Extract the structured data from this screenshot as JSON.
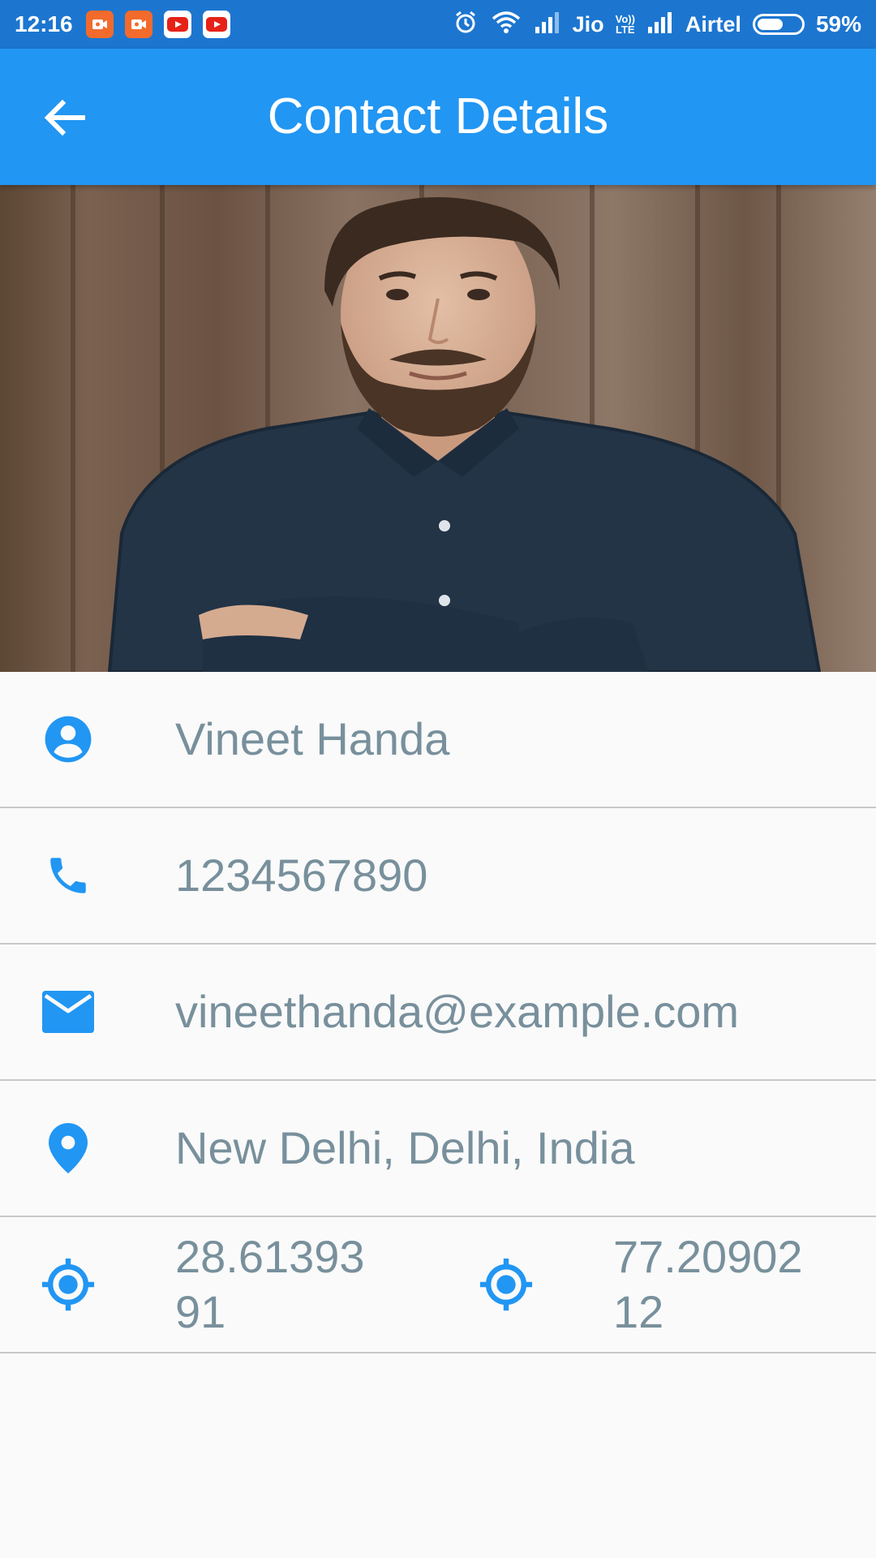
{
  "status_bar": {
    "time": "12:16",
    "carrier_1": "Jio",
    "volte_top": "Vo))",
    "volte_bottom": "LTE",
    "carrier_2": "Airtel",
    "battery_percent": "59%",
    "battery_level": 0.59
  },
  "app_bar": {
    "title": "Contact Details"
  },
  "contact": {
    "name": "Vineet Handa",
    "phone": "1234567890",
    "email": "vineethanda@example.com",
    "address": "New Delhi, Delhi, India",
    "latitude": "28.61393\n91",
    "longitude": "77.20902\n12"
  },
  "colors": {
    "status_bar": "#1c76d0",
    "app_bar": "#2196f3",
    "icon": "#2196f3",
    "text": "#78909c",
    "divider": "#c8c8c8",
    "background": "#fafafa"
  },
  "icons": {
    "back": "arrow-back-icon",
    "name": "account-circle-icon",
    "phone": "phone-icon",
    "email": "mail-icon",
    "address": "location-pin-icon",
    "latitude": "gps-target-icon",
    "longitude": "gps-target-icon"
  }
}
